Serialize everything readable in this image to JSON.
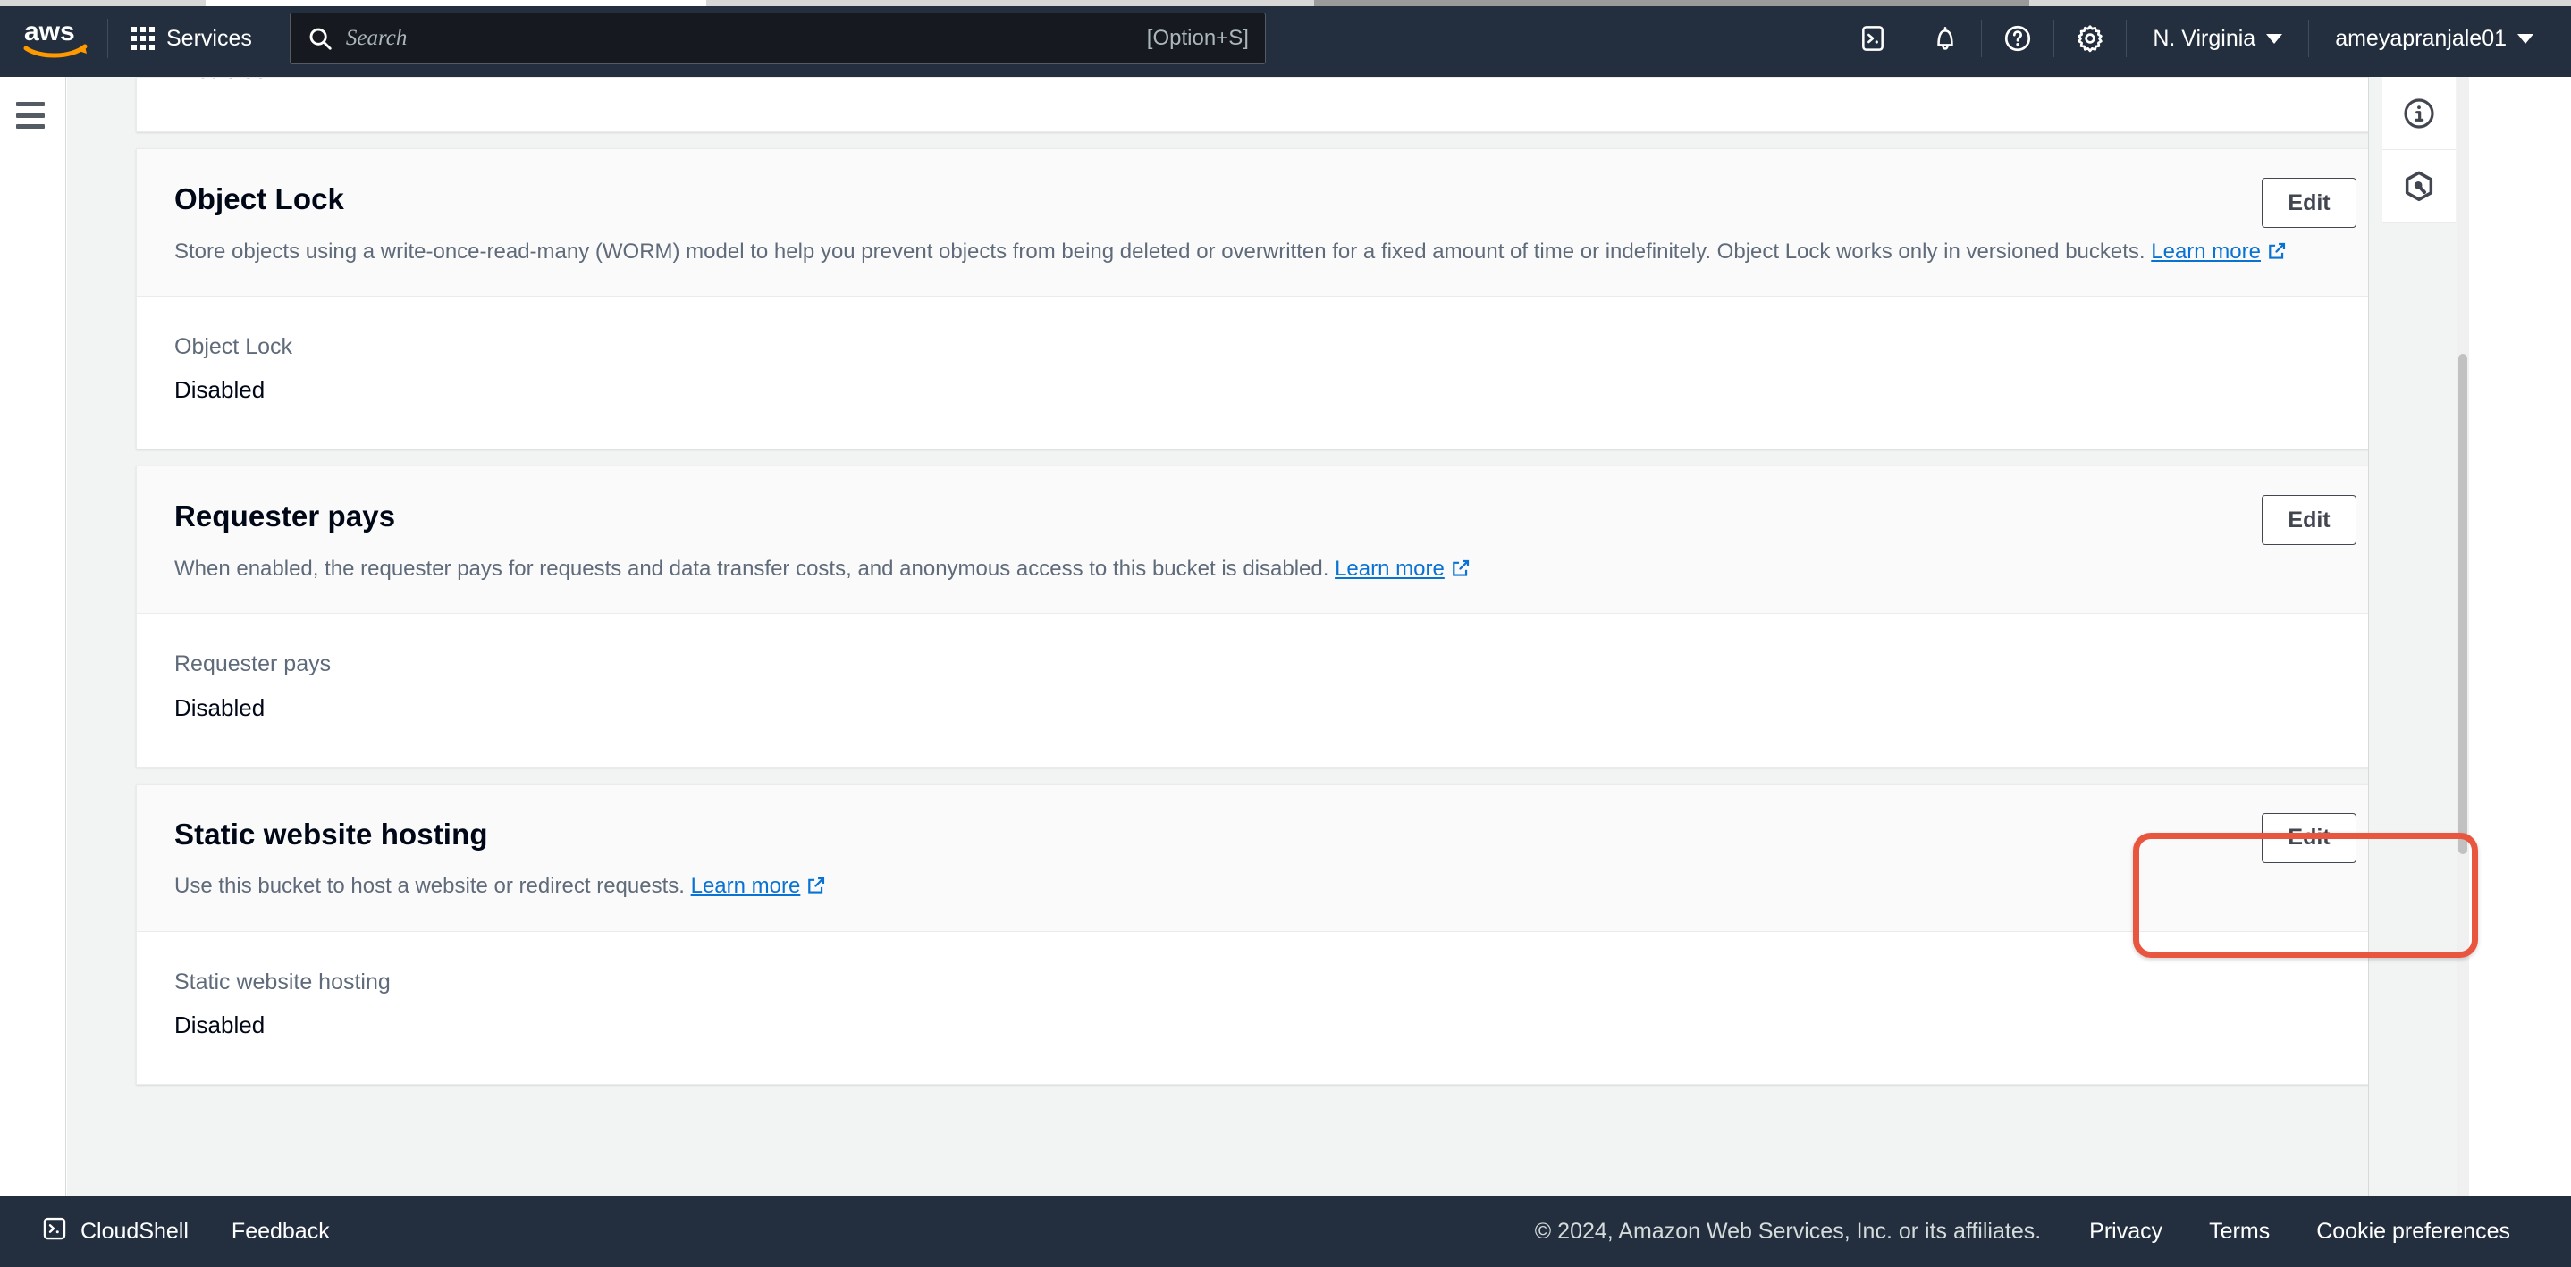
{
  "topnav": {
    "logo_alt": "aws",
    "services_label": "Services",
    "search": {
      "placeholder": "Search",
      "value": "",
      "hint": "[Option+S]"
    },
    "icons": [
      {
        "name": "cloudshell-icon",
        "title": "CloudShell"
      },
      {
        "name": "notifications-bell-icon",
        "title": "Notifications"
      },
      {
        "name": "help-question-icon",
        "title": "Help"
      },
      {
        "name": "settings-gear-icon",
        "title": "Settings"
      }
    ],
    "region_label": "N. Virginia",
    "account_label": "ameyapranjale01"
  },
  "content": {
    "partial_top_card": {
      "cut_value": "Disabled"
    },
    "cards": [
      {
        "title": "Object Lock",
        "description_before_link": "Store objects using a write-once-read-many (WORM) model to help you prevent objects from being deleted or overwritten for a fixed amount of time or indefinitely. Object Lock works only in versioned buckets.",
        "link_label": "Learn more",
        "edit_label": "Edit",
        "field_label": "Object Lock",
        "field_value": "Disabled",
        "highlighted": false
      },
      {
        "title": "Requester pays",
        "description_before_link": "When enabled, the requester pays for requests and data transfer costs, and anonymous access to this bucket is disabled.",
        "link_label": "Learn more",
        "edit_label": "Edit",
        "field_label": "Requester pays",
        "field_value": "Disabled",
        "highlighted": false
      },
      {
        "title": "Static website hosting",
        "description_before_link": "Use this bucket to host a website or redirect requests.",
        "link_label": "Learn more",
        "edit_label": "Edit",
        "field_label": "Static website hosting",
        "field_value": "Disabled",
        "highlighted": true
      }
    ]
  },
  "right_rail": {
    "buttons": [
      {
        "name": "info-panel-icon",
        "title": "Info"
      },
      {
        "name": "amazon-q-hexagon-icon",
        "title": "Amazon Q"
      }
    ]
  },
  "footer": {
    "cloudshell_label": "CloudShell",
    "feedback_label": "Feedback",
    "copyright": "© 2024, Amazon Web Services, Inc. or its affiliates.",
    "links": [
      "Privacy",
      "Terms",
      "Cookie preferences"
    ]
  },
  "colors": {
    "nav_background": "#232f3e",
    "page_background": "#f2f3f3",
    "card_background": "#ffffff",
    "link_blue": "#0972d3",
    "highlight_red": "#e8563f",
    "text_primary": "#000716",
    "text_secondary": "#5f6b7a",
    "button_border": "#424650"
  }
}
